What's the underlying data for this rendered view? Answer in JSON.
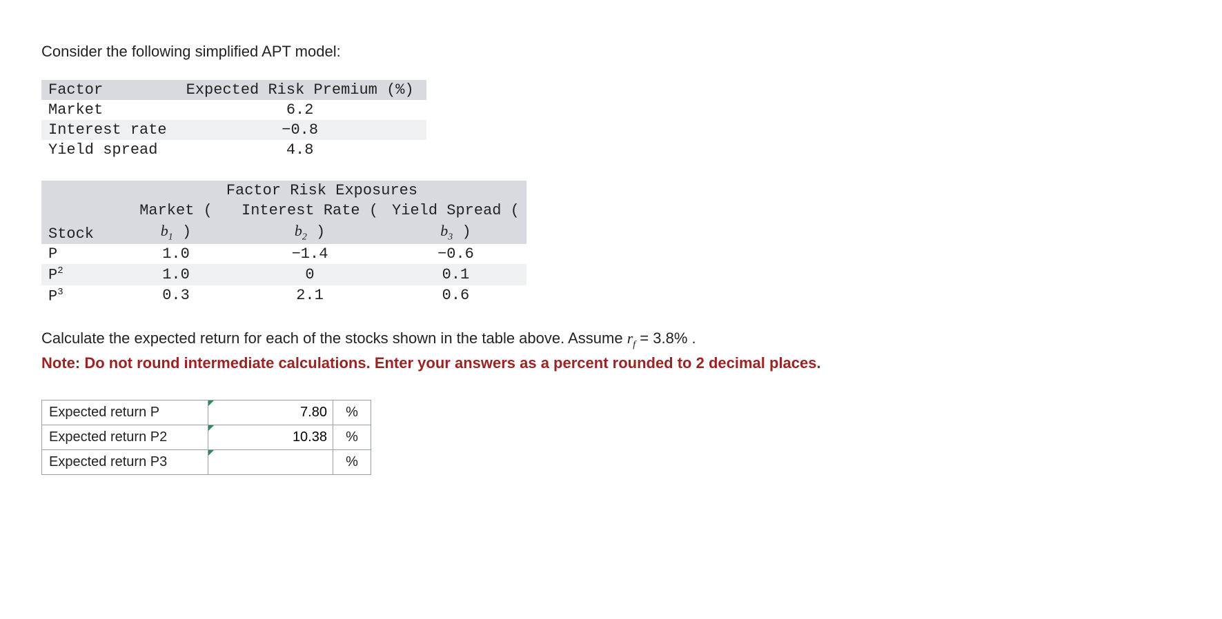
{
  "intro": "Consider the following simplified APT model:",
  "premium": {
    "headers": [
      "Factor",
      "Expected Risk Premium (%)"
    ],
    "rows": [
      {
        "factor": "Market",
        "value": "6.2"
      },
      {
        "factor": "Interest rate",
        "value": "−0.8"
      },
      {
        "factor": "Yield spread",
        "value": "4.8"
      }
    ]
  },
  "exposures": {
    "title": "Factor Risk Exposures",
    "col_stock": "Stock",
    "col_market_pre": "Market (",
    "col_market_sym": "b",
    "col_market_sub": "1",
    "col_market_post": " )",
    "col_ir_pre": "Interest Rate (",
    "col_ir_sym": "b",
    "col_ir_sub": "2",
    "col_ir_post": " )",
    "col_ys_pre": "Yield Spread (",
    "col_ys_sym": "b",
    "col_ys_sub": "3",
    "col_ys_post": " )",
    "rows": [
      {
        "stock": "P",
        "b1": "1.0",
        "b2": "−1.4",
        "b3": "−0.6"
      },
      {
        "stock": "P",
        "stock_sup": "2",
        "b1": "1.0",
        "b2": "0",
        "b3": "0.1"
      },
      {
        "stock": "P",
        "stock_sup": "3",
        "b1": "0.3",
        "b2": "2.1",
        "b3": "0.6"
      }
    ]
  },
  "question": {
    "pre": "Calculate the expected return for each of the stocks shown in the table above. Assume ",
    "var": "r",
    "var_sub": "f",
    "eq": " = 3.8% .",
    "note": "Note: Do not round intermediate calculations. Enter your answers as a percent rounded to 2 decimal places."
  },
  "answers": {
    "unit": "%",
    "rows": [
      {
        "label": "Expected return P",
        "value": "7.80"
      },
      {
        "label": "Expected return P2",
        "value": "10.38"
      },
      {
        "label": "Expected return P3",
        "value": ""
      }
    ]
  }
}
